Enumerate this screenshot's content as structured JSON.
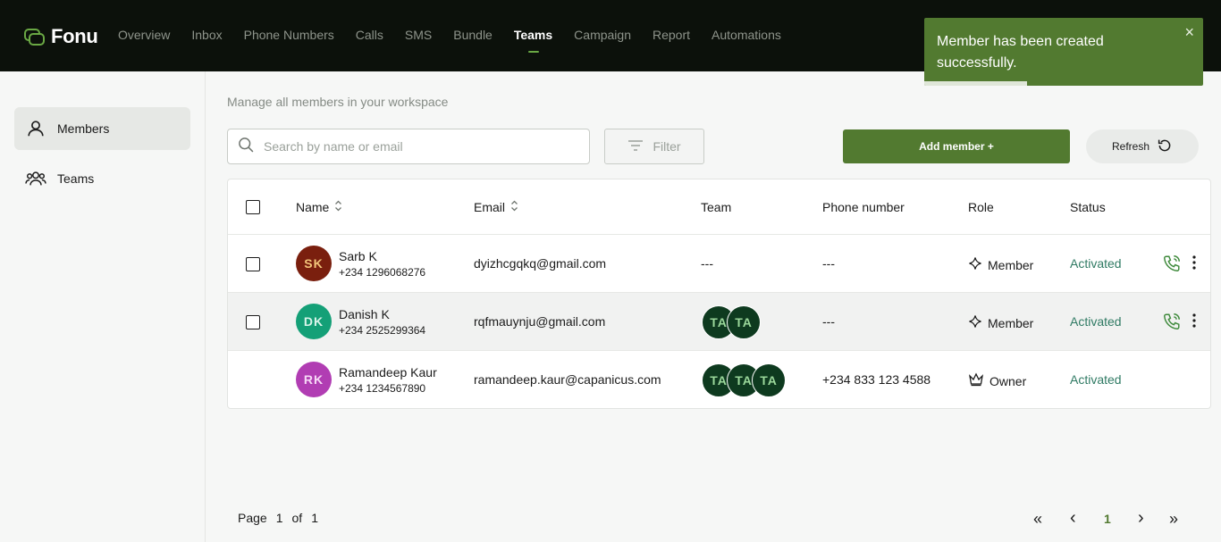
{
  "app": {
    "name": "Fonu"
  },
  "nav": {
    "items": [
      {
        "label": "Overview"
      },
      {
        "label": "Inbox"
      },
      {
        "label": "Phone Numbers"
      },
      {
        "label": "Calls"
      },
      {
        "label": "SMS"
      },
      {
        "label": "Bundle"
      },
      {
        "label": "Teams",
        "active": true
      },
      {
        "label": "Campaign"
      },
      {
        "label": "Report"
      },
      {
        "label": "Automations"
      }
    ]
  },
  "toast": {
    "message": "Member has been created successfully.",
    "close": "×"
  },
  "sidebar": {
    "items": [
      {
        "label": "Members",
        "icon": "user-icon",
        "active": true
      },
      {
        "label": "Teams",
        "icon": "users-icon"
      }
    ]
  },
  "main": {
    "subtitle": "Manage all members in your workspace",
    "search": {
      "placeholder": "Search by name or email"
    },
    "filter_label": "Filter",
    "add_label": "Add member +",
    "refresh_label": "Refresh"
  },
  "table": {
    "headers": {
      "name": "Name",
      "email": "Email",
      "team": "Team",
      "phone": "Phone number",
      "role": "Role",
      "status": "Status"
    },
    "rows": [
      {
        "initials": "SK",
        "avatar_color": "#7a1f0e",
        "initials_color": "#f2c57a",
        "name": "Sarb K",
        "phone": "+234 1296068276",
        "email": "dyizhcgqkq@gmail.com",
        "team": "---",
        "phone_number": "---",
        "role": "Member",
        "status": "Activated"
      },
      {
        "initials": "DK",
        "avatar_color": "#14a077",
        "initials_color": "#d9f4ea",
        "name": "Danish K",
        "phone": "+234 2525299364",
        "email": "rqfmauynju@gmail.com",
        "team_badges": [
          "TA",
          "TA"
        ],
        "phone_number": "---",
        "role": "Member",
        "status": "Activated"
      },
      {
        "initials": "RK",
        "avatar_color": "#b13db3",
        "initials_color": "#f6d9f6",
        "name": "Ramandeep Kaur",
        "phone": "+234 1234567890",
        "email": "ramandeep.kaur@capanicus.com",
        "team_badges": [
          "TA",
          "TA",
          "TA"
        ],
        "phone_number": "+234 833 123 4588",
        "role": "Owner",
        "status": "Activated"
      }
    ]
  },
  "pagination": {
    "page_label": "Page",
    "current": "1",
    "of_label": "of",
    "total": "1",
    "first": "«",
    "prev": "‹",
    "page_button": "1",
    "next": "›",
    "last": "»"
  },
  "colors": {
    "accent": "#527a30",
    "status": "#2f7a63",
    "topbar": "#0c110b"
  }
}
